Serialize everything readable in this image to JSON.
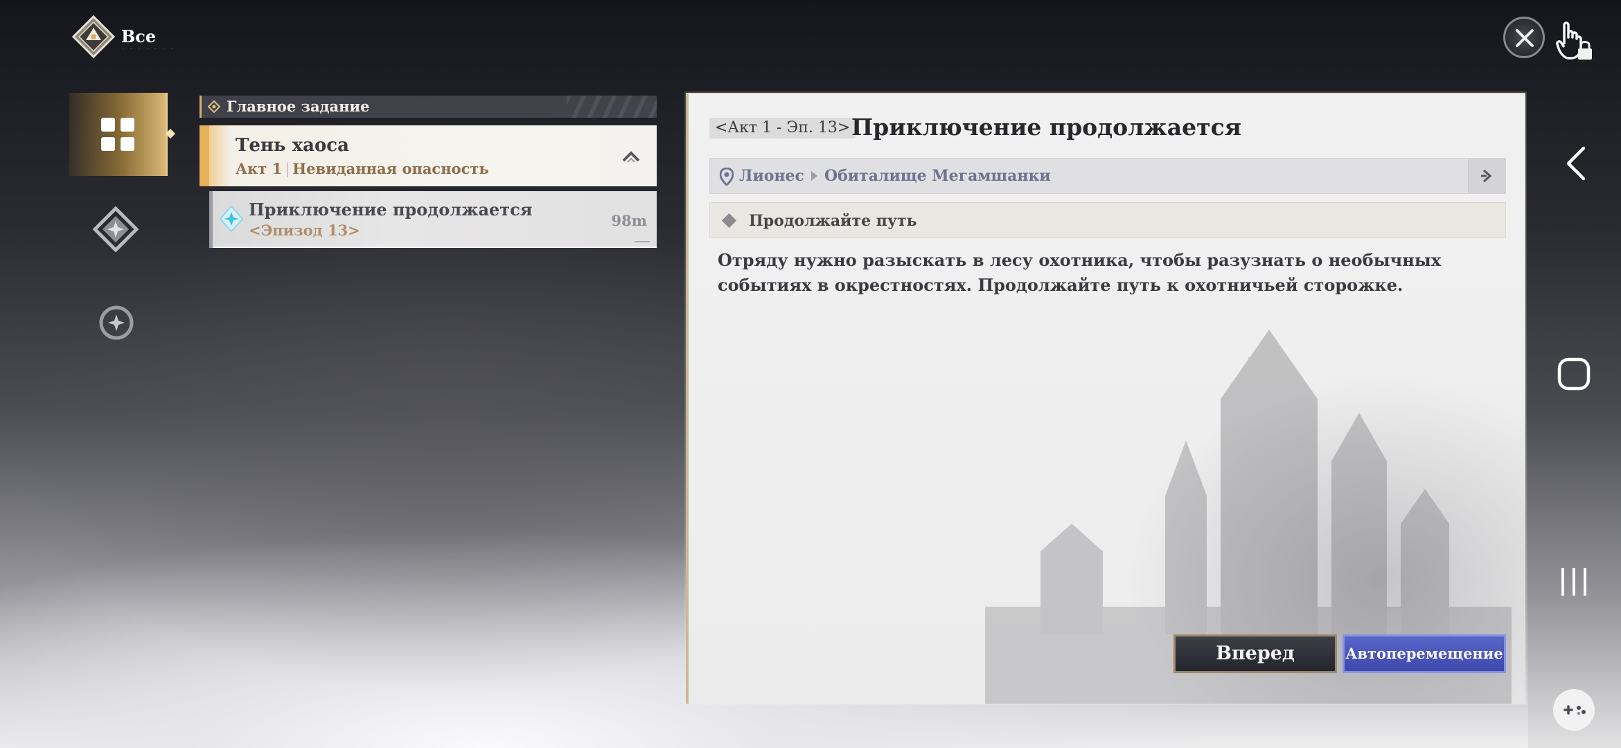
{
  "header": {
    "title": "Все"
  },
  "categories": [
    {
      "name": "all",
      "icon": "grid-icon",
      "active": true
    },
    {
      "name": "main",
      "icon": "diamond-star-icon",
      "active": false
    },
    {
      "name": "side",
      "icon": "circle-star-icon",
      "active": false
    }
  ],
  "quest_list": {
    "section_label": "Главное задание",
    "quest": {
      "title": "Тень хаоса",
      "act": "Акт 1",
      "act_name": "Невиданная опасность"
    },
    "subquest": {
      "title": "Приключение продолжается",
      "episode": "<Эпизод 13>",
      "distance": "98m"
    }
  },
  "detail": {
    "episode_tag": "<Акт 1 - Эп. 13>",
    "title": "Приключение продолжается",
    "location": {
      "region": "Лионес",
      "area": "Обиталище Мегамшанки"
    },
    "objective": "Продолжайте путь",
    "description": "Отряду нужно разыскать в лесу охотника, чтобы разузнать о необычных событиях в окрестностях. Продолжайте путь к охотничьей сторожке.",
    "buttons": {
      "forward": "Вперед",
      "auto": "Автоперемещение"
    }
  },
  "colors": {
    "accent_gold": "#d9b877",
    "auto_button": "#4a55ba",
    "location_text": "#6d7392"
  }
}
